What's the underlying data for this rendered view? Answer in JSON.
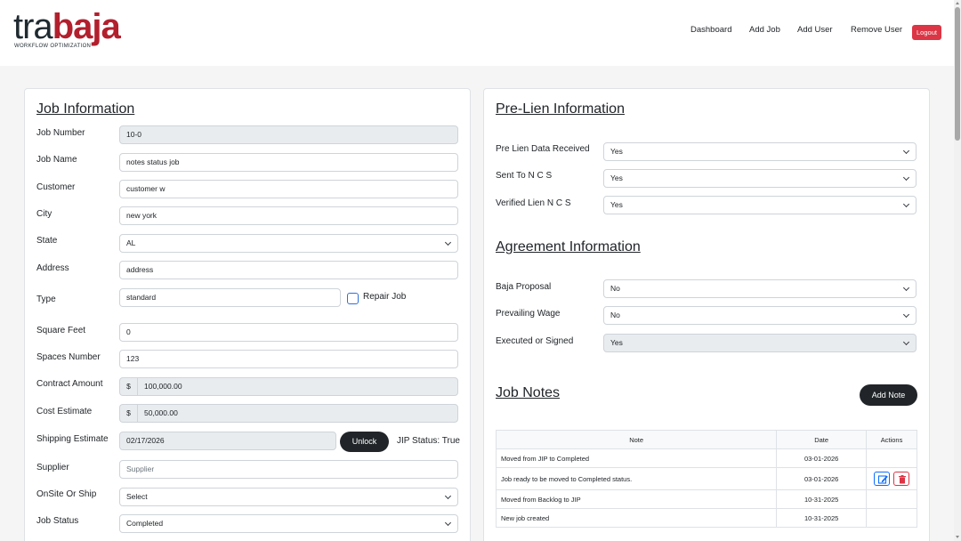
{
  "brand": {
    "name_part1": "tra",
    "name_part2": "baja",
    "tagline": "WORKFLOW OPTIMIZATION"
  },
  "nav": {
    "dashboard": "Dashboard",
    "add_job": "Add Job",
    "add_user": "Add User",
    "remove_user": "Remove User",
    "logout": "Logout"
  },
  "job_info": {
    "title": "Job Information",
    "job_number": {
      "label": "Job Number",
      "value": "10-0"
    },
    "job_name": {
      "label": "Job Name",
      "value": "notes status job"
    },
    "customer": {
      "label": "Customer",
      "value": "customer w"
    },
    "city": {
      "label": "City",
      "value": "new york"
    },
    "state": {
      "label": "State",
      "value": "AL"
    },
    "address": {
      "label": "Address",
      "value": "address"
    },
    "type": {
      "label": "Type",
      "value": "standard",
      "repair_label": "Repair Job",
      "repair_checked": false
    },
    "square_feet": {
      "label": "Square Feet",
      "value": "0"
    },
    "spaces_number": {
      "label": "Spaces Number",
      "value": "123"
    },
    "contract_amount": {
      "label": "Contract Amount",
      "prefix": "$",
      "value": "100,000.00"
    },
    "cost_estimate": {
      "label": "Cost Estimate",
      "prefix": "$",
      "value": "50,000.00"
    },
    "shipping_estimate": {
      "label": "Shipping Estimate",
      "value": "02/17/2026",
      "unlock_label": "Unlock",
      "jip_status": "JIP Status: True"
    },
    "supplier": {
      "label": "Supplier",
      "placeholder": "Supplier"
    },
    "onsite_or_ship": {
      "label": "OnSite Or Ship",
      "value": "Select"
    },
    "job_status": {
      "label": "Job Status",
      "value": "Completed"
    }
  },
  "pre_lien": {
    "title": "Pre-Lien Information",
    "data_received": {
      "label": "Pre Lien Data Received",
      "value": "Yes"
    },
    "sent_to_ncs": {
      "label": "Sent To N C S",
      "value": "Yes"
    },
    "verified_lien_ncs": {
      "label": "Verified Lien N C S",
      "value": "Yes"
    }
  },
  "agreement": {
    "title": "Agreement Information",
    "baja_proposal": {
      "label": "Baja Proposal",
      "value": "No"
    },
    "prevailing_wage": {
      "label": "Prevailing Wage",
      "value": "No"
    },
    "executed_or_signed": {
      "label": "Executed or Signed",
      "value": "Yes"
    }
  },
  "job_notes": {
    "title": "Job Notes",
    "add_note_label": "Add Note",
    "headers": {
      "note": "Note",
      "date": "Date",
      "actions": "Actions"
    },
    "rows": [
      {
        "note": "Moved from JIP to Completed",
        "date": "03-01-2026"
      },
      {
        "note": "Job ready to be moved to Completed status.",
        "date": "03-01-2026"
      },
      {
        "note": "Moved from Backlog to JIP",
        "date": "10-31-2025"
      },
      {
        "note": "New job created",
        "date": "10-31-2025"
      }
    ]
  },
  "colors": {
    "brand_red": "#b21f2d",
    "logout_red": "#dc3545",
    "dark_button": "#212529",
    "edit_blue": "#0d6efd"
  }
}
